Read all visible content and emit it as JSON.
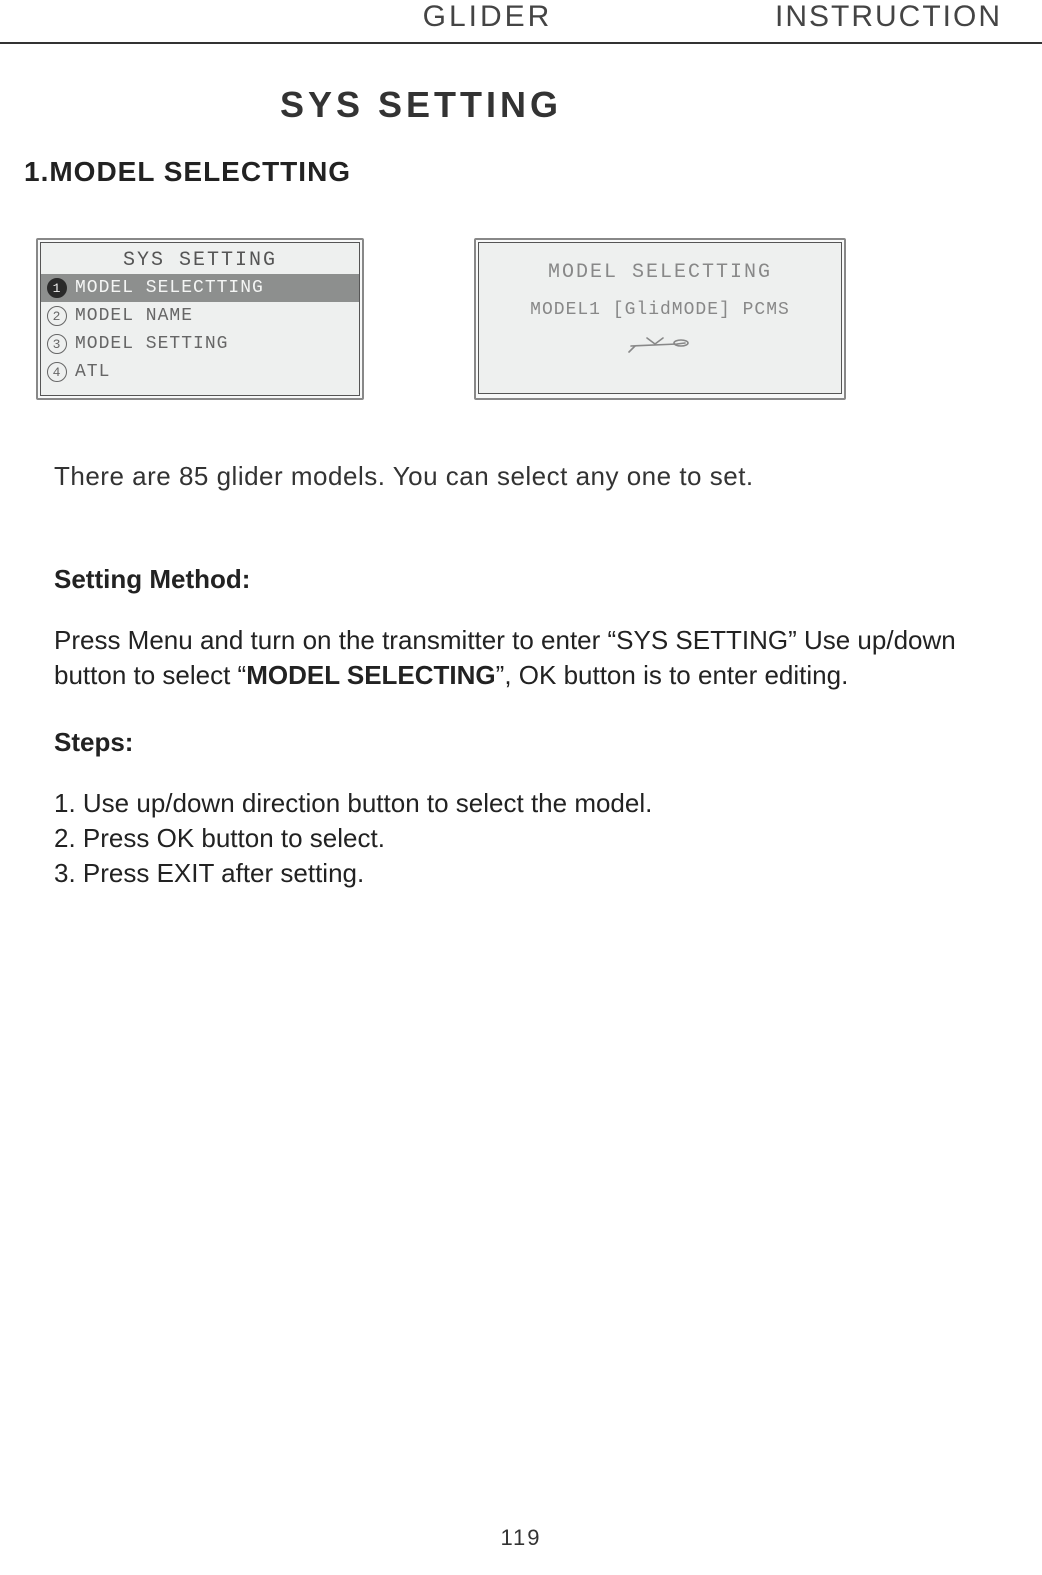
{
  "header": {
    "left": "GLIDER",
    "right": "INSTRUCTION"
  },
  "page_title": "SYS  SETTING",
  "section_heading": "1.MODEL SELECTTING",
  "screen1": {
    "title": "SYS SETTING",
    "items": [
      {
        "num": "1",
        "label": "MODEL SELECTTING",
        "selected": true
      },
      {
        "num": "2",
        "label": "MODEL NAME",
        "selected": false
      },
      {
        "num": "3",
        "label": "MODEL SETTING",
        "selected": false
      },
      {
        "num": "4",
        "label": "ATL",
        "selected": false
      }
    ]
  },
  "screen2": {
    "title": "MODEL SELECTTING",
    "line": "MODEL1  [GlidMODE] PCMS"
  },
  "intro_text": "There are 85 glider models. You can select any one to set.",
  "method_heading": "Setting Method:",
  "method_para_pre": "Press Menu and turn on the transmitter to enter “SYS SETTING” Use up/down button to select “",
  "method_para_bold": "MODEL SELECTING",
  "method_para_post": "”, OK button is to enter editing.",
  "steps_heading": "Steps:",
  "steps": [
    "1. Use up/down direction button to select the model.",
    "2. Press OK button to select.",
    "3. Press EXIT after setting."
  ],
  "page_number": "119"
}
